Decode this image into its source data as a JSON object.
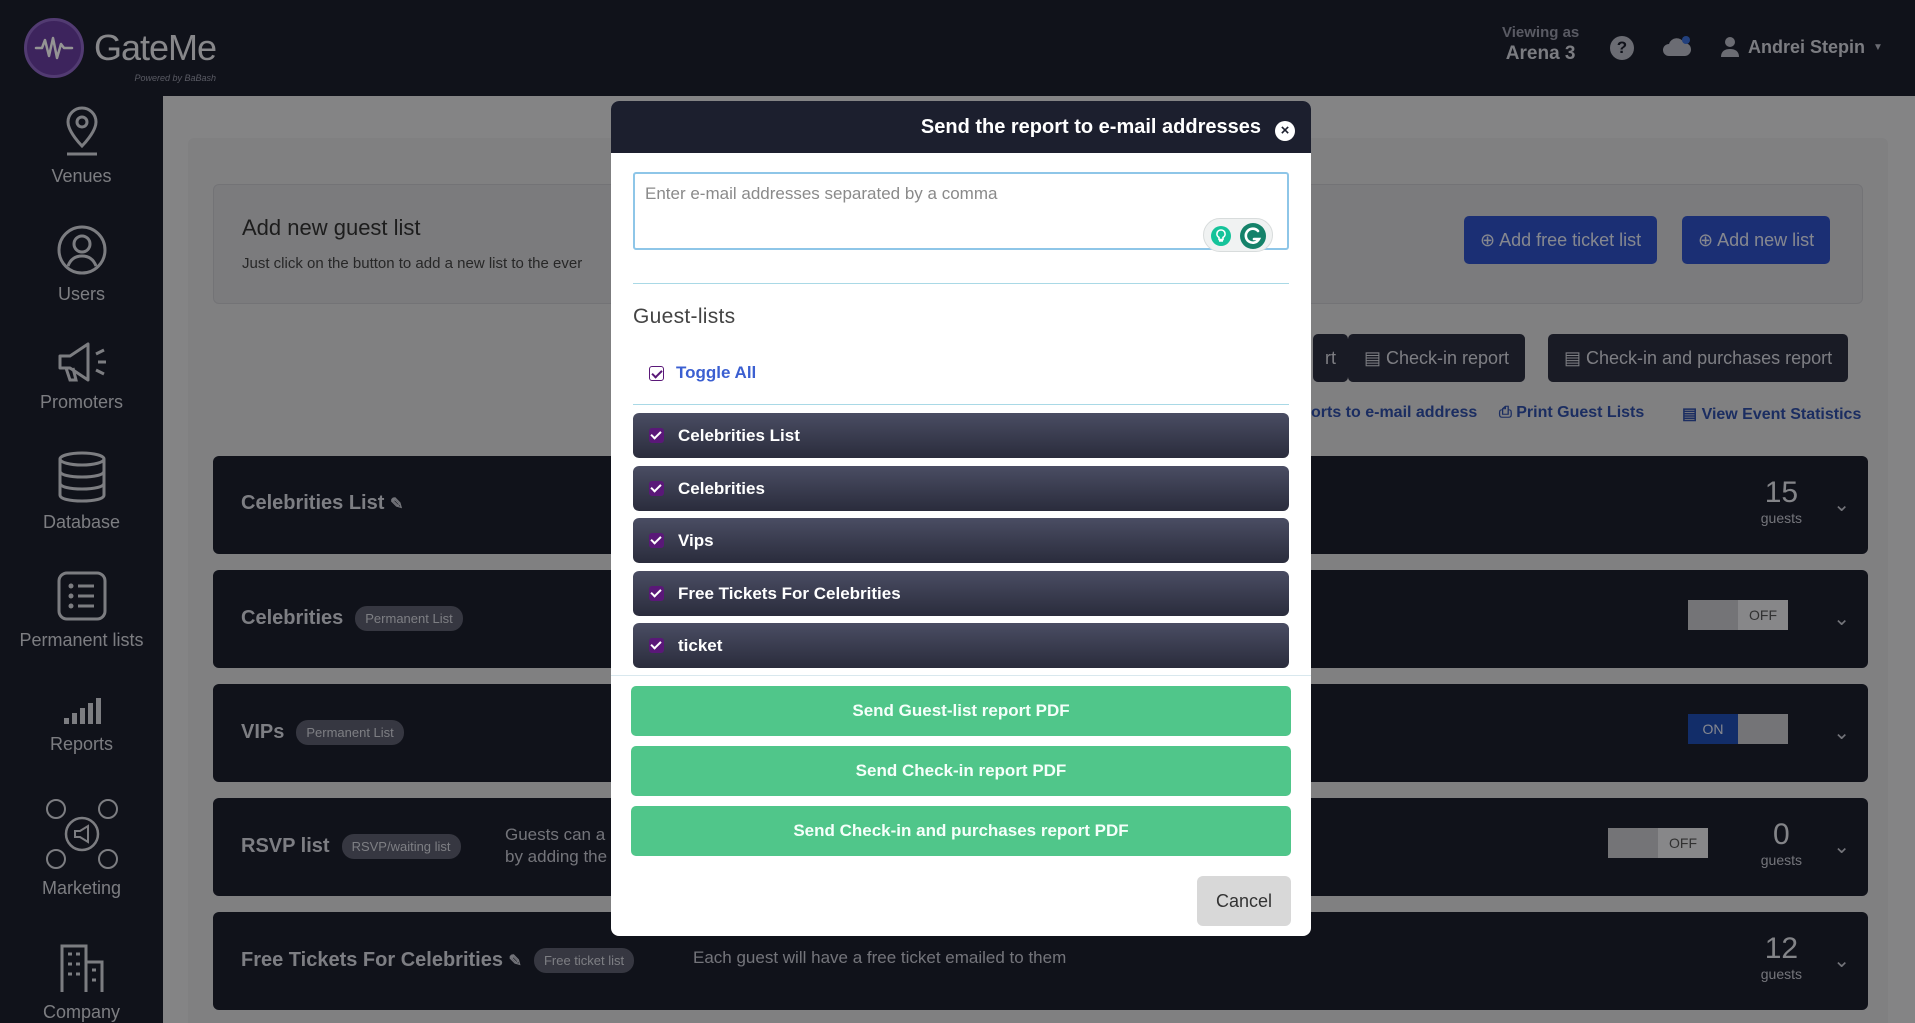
{
  "header": {
    "brand": "GateMe",
    "brand_sub": "Powered by BaBash",
    "viewing_as_label": "Viewing as",
    "viewing_as_venue": "Arena 3",
    "help_glyph": "?",
    "user_name": "Andrei Stepin"
  },
  "sidebar": {
    "items": [
      {
        "label": "Venues",
        "icon": "map-pin-icon"
      },
      {
        "label": "Users",
        "icon": "user-icon"
      },
      {
        "label": "Promoters",
        "icon": "megaphone-icon"
      },
      {
        "label": "Database",
        "icon": "database-icon"
      },
      {
        "label": "Permanent lists",
        "icon": "list-icon"
      },
      {
        "label": "Reports",
        "icon": "bar-chart-icon"
      },
      {
        "label": "Marketing",
        "icon": "social-icon"
      },
      {
        "label": "Company",
        "icon": "building-icon"
      }
    ]
  },
  "background": {
    "add_title": "Add new guest list",
    "add_text": "Just click on the button to add a new list to the ever",
    "add_free_ticket_list": "Add free ticket list",
    "add_new_list": "Add new list",
    "report_partial": "rt",
    "checkin_report": "Check-in report",
    "checkin_purchases_report": "Check-in and purchases report",
    "link_reports_email": "orts to e-mail address",
    "link_print": "Print Guest Lists",
    "link_stats": "View Event Statistics",
    "guests_label": "guests",
    "toggle_on": "ON",
    "toggle_off": "OFF",
    "rows": [
      {
        "name": "Celebrities List",
        "badge": "",
        "desc": "",
        "count": "15"
      },
      {
        "name": "Celebrities",
        "badge": "Permanent List",
        "desc": "",
        "count": ""
      },
      {
        "name": "VIPs",
        "badge": "Permanent List",
        "desc": "",
        "count": ""
      },
      {
        "name": "RSVP list",
        "badge": "RSVP/waiting list",
        "desc": "Guests can a",
        "desc2": "by adding the",
        "count": "0"
      },
      {
        "name": "Free Tickets For Celebrities",
        "badge": "Free ticket list",
        "desc": "Each guest will have a free ticket emailed to them",
        "count": "12"
      }
    ]
  },
  "modal": {
    "title": "Send the report to e-mail addresses",
    "email_placeholder": "Enter e-mail addresses separated by a comma",
    "email_value": "",
    "section_title": "Guest-lists",
    "toggle_all": "Toggle All",
    "guest_lists": [
      {
        "label": "Celebrities List",
        "checked": true
      },
      {
        "label": "Celebrities",
        "checked": true
      },
      {
        "label": "Vips",
        "checked": true
      },
      {
        "label": "Free Tickets For Celebrities",
        "checked": true
      },
      {
        "label": "ticket",
        "checked": true
      }
    ],
    "send_guestlist_pdf": "Send Guest-list report PDF",
    "send_checkin_pdf": "Send Check-in report PDF",
    "send_checkin_purchases_pdf": "Send Check-in and purchases report PDF",
    "cancel": "Cancel"
  },
  "colors": {
    "dark": "#1c1f2e",
    "accent_blue": "#2f52c9",
    "green": "#50c68a",
    "checkbox": "#5a1878"
  }
}
